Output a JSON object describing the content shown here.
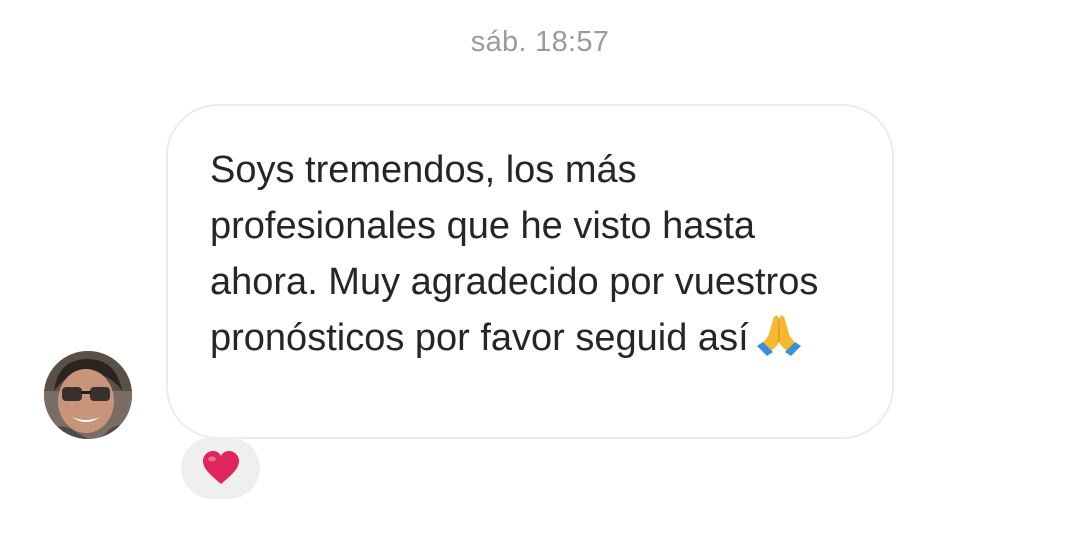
{
  "thread": {
    "timestamp": "sáb. 18:57"
  },
  "message": {
    "text": "Soys tremendos, los más profesionales que he visto hasta ahora. Muy agradecido por vuestros pronósticos por favor seguid así",
    "emoji": "pray-emoji",
    "reaction": "heart-icon"
  },
  "colors": {
    "timestamp": "#9b9b9b",
    "bubble_border": "#ececec",
    "text": "#262626",
    "reaction_bg": "#efefef",
    "heart": "#e0245e"
  }
}
